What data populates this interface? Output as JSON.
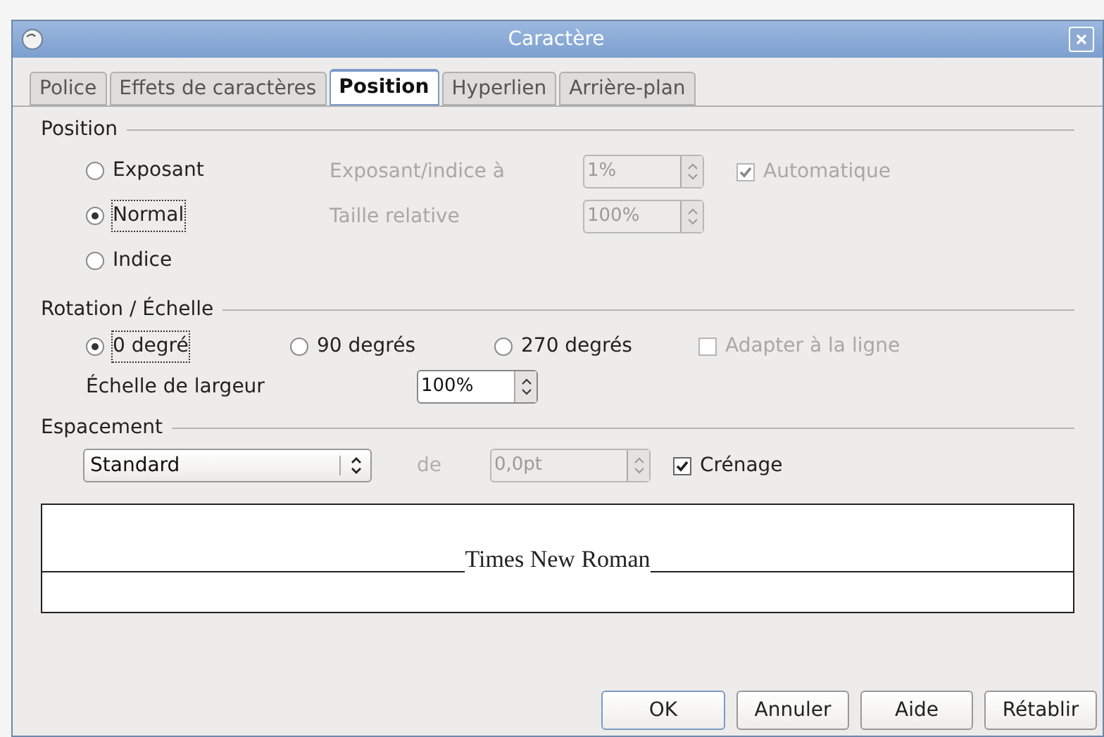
{
  "window": {
    "title": "Caractère"
  },
  "tabs": [
    {
      "label": "Police",
      "selected": false
    },
    {
      "label": "Effets de caractères",
      "selected": false
    },
    {
      "label": "Position",
      "selected": true
    },
    {
      "label": "Hyperlien",
      "selected": false
    },
    {
      "label": "Arrière-plan",
      "selected": false
    }
  ],
  "position": {
    "heading": "Position",
    "options": [
      {
        "label": "Exposant",
        "selected": false
      },
      {
        "label": "Normal",
        "selected": true
      },
      {
        "label": "Indice",
        "selected": false
      }
    ],
    "fields": [
      {
        "label": "Exposant/indice à",
        "value": "1%",
        "disabled": true
      },
      {
        "label": "Taille relative",
        "value": "100%",
        "disabled": true
      }
    ],
    "automatic": {
      "label": "Automatique",
      "checked": true,
      "disabled": true
    }
  },
  "rotation": {
    "heading": "Rotation / Échelle",
    "options": [
      {
        "label": "0 degré",
        "selected": true
      },
      {
        "label": "90 degrés",
        "selected": false
      },
      {
        "label": "270 degrés",
        "selected": false
      }
    ],
    "fit": {
      "label": "Adapter à la ligne",
      "checked": false,
      "disabled": true
    },
    "scale": {
      "label": "Échelle de largeur",
      "value": "100%"
    }
  },
  "spacing": {
    "heading": "Espacement",
    "mode": "Standard",
    "of_label": "de",
    "amount": "0,0pt",
    "amount_disabled": true,
    "kerning": {
      "label": "Crénage",
      "checked": true,
      "disabled": false
    }
  },
  "preview": {
    "text": "Times New Roman"
  },
  "buttons": [
    {
      "label": "OK",
      "default": true
    },
    {
      "label": "Annuler",
      "default": false
    },
    {
      "label": "Aide",
      "default": false
    },
    {
      "label": "Rétablir",
      "default": false
    }
  ]
}
